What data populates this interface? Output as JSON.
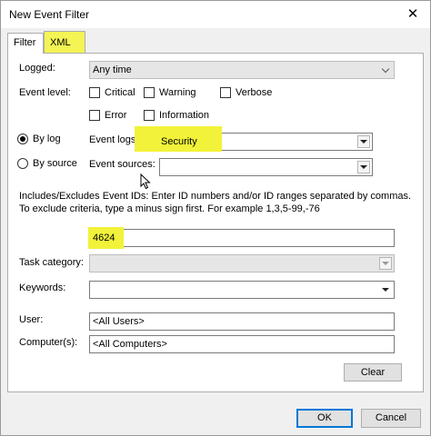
{
  "window": {
    "title": "New Event Filter",
    "close_glyph": "✕"
  },
  "tabs": [
    {
      "label": "Filter"
    },
    {
      "label": "XML"
    }
  ],
  "highlight_color": "#f2f23a",
  "logged": {
    "label": "Logged:",
    "value": "Any time"
  },
  "event_level": {
    "label": "Event level:",
    "options": [
      {
        "label": "Critical",
        "checked": false
      },
      {
        "label": "Warning",
        "checked": false
      },
      {
        "label": "Verbose",
        "checked": false
      },
      {
        "label": "Error",
        "checked": false
      },
      {
        "label": "Information",
        "checked": false
      }
    ]
  },
  "by_log": {
    "label": "By log",
    "selected": true
  },
  "by_source": {
    "label": "By source",
    "selected": false
  },
  "event_logs": {
    "label": "Event logs:",
    "value": "Security"
  },
  "event_sources": {
    "label": "Event sources:",
    "value": ""
  },
  "event_ids": {
    "description": "Includes/Excludes Event IDs: Enter ID numbers and/or ID ranges separated by commas. To exclude criteria, type a minus sign first. For example 1,3,5-99,-76",
    "value": "4624"
  },
  "task_category": {
    "label": "Task category:",
    "value": ""
  },
  "keywords": {
    "label": "Keywords:",
    "value": ""
  },
  "user": {
    "label": "User:",
    "value": "<All Users>"
  },
  "computer": {
    "label": "Computer(s):",
    "value": "<All Computers>"
  },
  "buttons": {
    "clear": "Clear",
    "ok": "OK",
    "cancel": "Cancel"
  }
}
